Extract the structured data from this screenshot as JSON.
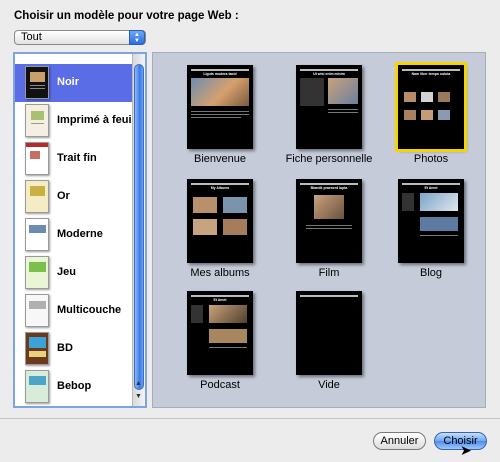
{
  "dialog": {
    "title": "Choisir un modèle pour votre page Web :",
    "category_select": "Tout"
  },
  "themes": [
    {
      "label": "Noir",
      "selected": true,
      "icon": "theme-noir-thumb"
    },
    {
      "label": "Imprimé à feuille",
      "selected": false,
      "icon": "theme-imprime-thumb"
    },
    {
      "label": "Trait fin",
      "selected": false,
      "icon": "theme-trait-fin-thumb"
    },
    {
      "label": "Or",
      "selected": false,
      "icon": "theme-or-thumb"
    },
    {
      "label": "Moderne",
      "selected": false,
      "icon": "theme-moderne-thumb"
    },
    {
      "label": "Jeu",
      "selected": false,
      "icon": "theme-jeu-thumb"
    },
    {
      "label": "Multicouche",
      "selected": false,
      "icon": "theme-multicouche-thumb"
    },
    {
      "label": "BD",
      "selected": false,
      "icon": "theme-bd-thumb"
    },
    {
      "label": "Bebop",
      "selected": false,
      "icon": "theme-bebop-thumb"
    }
  ],
  "templates": [
    {
      "label": "Bienvenue",
      "selected": false,
      "heading": "Liguts modera tacid"
    },
    {
      "label": "Fiche personnelle",
      "selected": false,
      "heading": "Ut wisi enim minim"
    },
    {
      "label": "Photos",
      "selected": true,
      "heading": "Nam liber tempo soluta"
    },
    {
      "label": "Mes albums",
      "selected": false,
      "heading": "My Albums"
    },
    {
      "label": "Film",
      "selected": false,
      "heading": "Blandit praesent lupta"
    },
    {
      "label": "Blog",
      "selected": false,
      "heading": "Et Amet"
    },
    {
      "label": "Podcast",
      "selected": false,
      "heading": "Et Amet"
    },
    {
      "label": "Vide",
      "selected": false,
      "heading": ""
    }
  ],
  "buttons": {
    "cancel": "Annuler",
    "choose": "Choisir"
  },
  "colors": {
    "selection": "#5a6de6",
    "template_highlight": "#f5d400",
    "default_button": "#4b8cec"
  }
}
